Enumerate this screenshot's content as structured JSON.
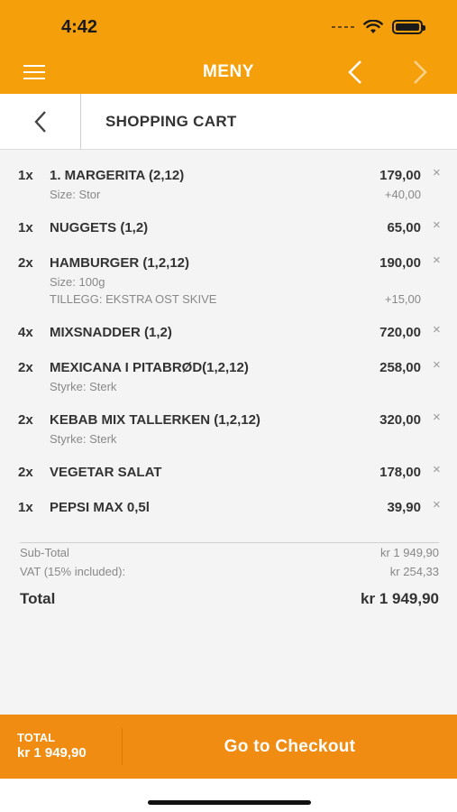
{
  "status_bar": {
    "time": "4:42"
  },
  "nav": {
    "title": "MENY"
  },
  "subheader": {
    "title": "SHOPPING CART"
  },
  "cart": {
    "remove_symbol": "×",
    "items": [
      {
        "qty": "1x",
        "name": "1. MARGERITA (2,12)",
        "price": "179,00",
        "details": [
          {
            "text": "Size: Stor",
            "price": "+40,00"
          }
        ]
      },
      {
        "qty": "1x",
        "name": "NUGGETS (1,2)",
        "price": "65,00",
        "details": []
      },
      {
        "qty": "2x",
        "name": "HAMBURGER (1,2,12)",
        "price": "190,00",
        "details": [
          {
            "text": "Size: 100g",
            "price": ""
          },
          {
            "text": "TILLEGG: EKSTRA OST SKIVE",
            "price": "+15,00"
          }
        ]
      },
      {
        "qty": "4x",
        "name": "MIXSNADDER (1,2)",
        "price": "720,00",
        "details": []
      },
      {
        "qty": "2x",
        "name": "MEXICANA I PITABRØD(1,2,12)",
        "price": "258,00",
        "details": [
          {
            "text": "Styrke: Sterk",
            "price": ""
          }
        ]
      },
      {
        "qty": "2x",
        "name": "KEBAB MIX TALLERKEN (1,2,12)",
        "price": "320,00",
        "details": [
          {
            "text": "Styrke: Sterk",
            "price": ""
          }
        ]
      },
      {
        "qty": "2x",
        "name": "VEGETAR SALAT",
        "price": "178,00",
        "details": []
      },
      {
        "qty": "1x",
        "name": "PEPSI MAX 0,5l",
        "price": "39,90",
        "details": []
      }
    ]
  },
  "summary": {
    "subtotal_label": "Sub-Total",
    "subtotal_value": "kr 1 949,90",
    "vat_label": "VAT (15% included):",
    "vat_value": "kr 254,33",
    "total_label": "Total",
    "total_value": "kr 1 949,90"
  },
  "footer": {
    "total_label": "TOTAL",
    "total_value": "kr 1 949,90",
    "checkout_label": "Go to Checkout"
  },
  "colors": {
    "header": "#f5a00b",
    "footer": "#f18c13",
    "background": "#f4f4f4"
  }
}
